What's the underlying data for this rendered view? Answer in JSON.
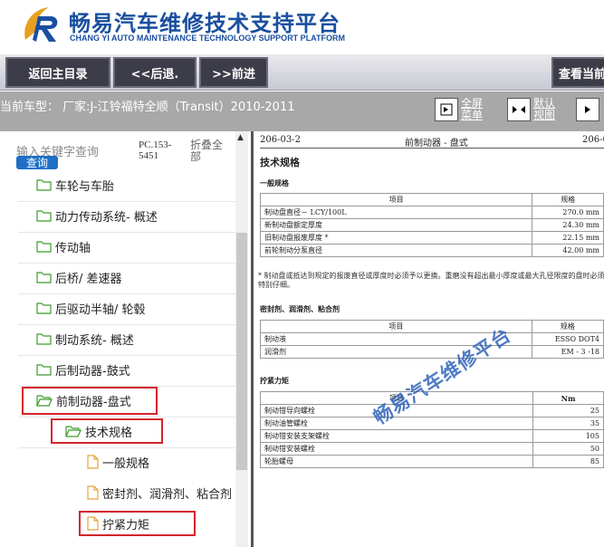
{
  "header": {
    "title": "畅易汽车维修技术支持平台",
    "subtitle": "CHANG YI AUTO MAINTENANCE TECHNOLOGY SUPPORT PLATFORM",
    "brand_color": "#1a4fa0"
  },
  "toolbar": {
    "home_label": "返回主目录",
    "back_label": "<<后退.",
    "forward_label": ">>前进",
    "view_label": "查看当前"
  },
  "vehicle": {
    "text": "当前车型： 厂家:J-江铃福特全顺（Transit）2010-2011",
    "fullscreen_label": "全屏\n菜单",
    "default_view_label": "默认\n视图"
  },
  "search": {
    "placeholder": "输入关键字查询",
    "button_label": "查询",
    "pc_code": "PC.153-5451",
    "collapse_label": "折叠全部"
  },
  "tree": [
    {
      "label": "车轮与车胎",
      "icon": "folder-icon"
    },
    {
      "label": "动力传动系统- 概述",
      "icon": "folder-icon"
    },
    {
      "label": "传动轴",
      "icon": "folder-icon"
    },
    {
      "label": "后桥/ 差速器",
      "icon": "folder-icon"
    },
    {
      "label": "后驱动半轴/ 轮毂",
      "icon": "folder-icon"
    },
    {
      "label": "制动系统- 概述",
      "icon": "folder-icon"
    },
    {
      "label": "后制动器-鼓式",
      "icon": "folder-icon"
    },
    {
      "label": "前制动器-盘式",
      "icon": "folder-open-icon"
    },
    {
      "label": "技术规格",
      "icon": "folder-open-icon"
    },
    {
      "label": "一般规格",
      "icon": "document-icon"
    },
    {
      "label": "密封剂、润滑剂、粘合剂",
      "icon": "document-icon"
    },
    {
      "label": "拧紧力矩",
      "icon": "document-icon"
    }
  ],
  "document": {
    "page_left": "206-03-2",
    "page_title": "前制动器 - 盘式",
    "page_right": "206-0",
    "heading": "技术规格",
    "section_general": "一般规格",
    "col_item": "项目",
    "col_spec": "规格",
    "general_rows": [
      {
        "item": "制动盘直径－ LCY/100L",
        "value": "270.0 mm"
      },
      {
        "item": "新制动盘额定厚度",
        "value": "24.30 mm"
      },
      {
        "item": "旧制动盘报废厚度 *",
        "value": "22.15 mm"
      },
      {
        "item": "前轮制动分泵直径",
        "value": "42.00 mm"
      }
    ],
    "note": "* 制动盘或抵达到规定的报废直径或厚度时必须予以更换。重磨没有超出最小厚度或最大孔径限度的盘时必须特别仔细。",
    "section_sealant": "密封剂、润滑剂、粘合剂",
    "sealant_rows": [
      {
        "item": "制动液",
        "value": "ESSO DOT4"
      },
      {
        "item": "润滑剂",
        "value": "EM - 3 -18"
      }
    ],
    "section_torque": "拧紧力矩",
    "col_nm": "Nm",
    "torque_rows": [
      {
        "item": "制动钳导向螺栓",
        "value": "25"
      },
      {
        "item": "制动油管螺栓",
        "value": "35"
      },
      {
        "item": "制动钳安装支架螺栓",
        "value": "105"
      },
      {
        "item": "制动钳安装螺栓",
        "value": "50"
      },
      {
        "item": "轮胎螺母",
        "value": "85"
      }
    ],
    "watermark": "畅易汽车维修平台"
  }
}
